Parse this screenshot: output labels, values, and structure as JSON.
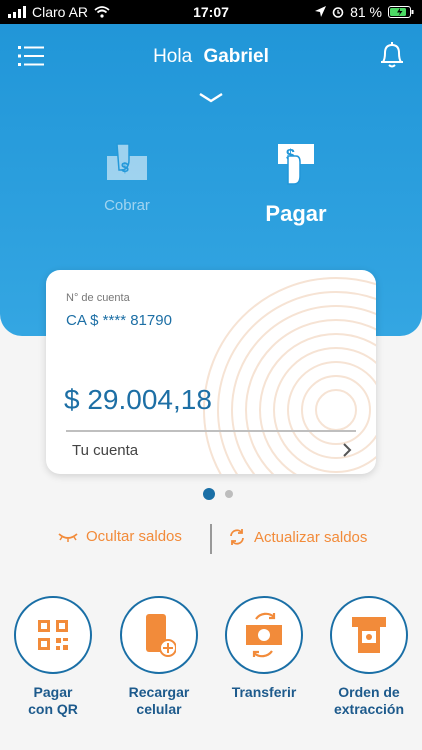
{
  "status_bar": {
    "carrier": "Claro AR",
    "time": "17:07",
    "battery_percent": "81 %"
  },
  "header": {
    "greeting": "Hola",
    "user_name": "Gabriel"
  },
  "actions": {
    "cobrar_label": "Cobrar",
    "pagar_label": "Pagar"
  },
  "account_card": {
    "account_label": "N° de cuenta",
    "account_number": "CA $ **** 81790",
    "balance": "$ 29.004,18",
    "link_label": "Tu cuenta"
  },
  "pagination": {
    "current": 1,
    "total": 2
  },
  "balance_actions": {
    "hide_label": "Ocultar saldos",
    "update_label": "Actualizar saldos"
  },
  "shortcuts": [
    {
      "label_line1": "Pagar",
      "label_line2": "con QR"
    },
    {
      "label_line1": "Recargar",
      "label_line2": "celular"
    },
    {
      "label_line1": "Transferir",
      "label_line2": ""
    },
    {
      "label_line1": "Orden de",
      "label_line2": "extracción"
    }
  ],
  "colors": {
    "header_blue": "#2196d8",
    "accent_orange": "#f28b3a",
    "primary_dark_blue": "#1a6fa6"
  }
}
